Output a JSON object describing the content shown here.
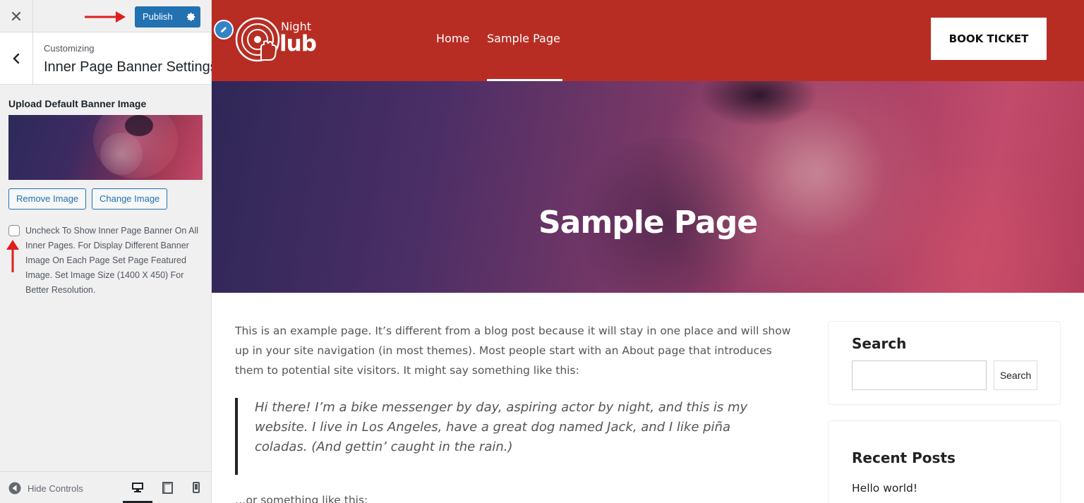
{
  "customizer": {
    "close_icon": "close-icon",
    "publish_label": "Publish",
    "settings_icon": "gear-icon",
    "customizing_label": "Customizing",
    "section_title": "Inner Page Banner Settings",
    "control_title": "Upload Default Banner Image",
    "remove_image_label": "Remove Image",
    "change_image_label": "Change Image",
    "checkbox_checked": false,
    "checkbox_label": "Uncheck To Show Inner Page Banner On All Inner Pages. For Display Different Banner Image On Each Page Set Page Featured Image. Set Image Size (1400 X 450) For Better Resolution.",
    "hide_controls_label": "Hide Controls",
    "devices": [
      "desktop",
      "tablet",
      "mobile"
    ],
    "active_device": "desktop",
    "accent_color": "#2271b1",
    "annotation_arrow_color": "#e01e1e"
  },
  "site": {
    "logo_top": "Night",
    "logo_bottom": "lub",
    "nav": [
      {
        "label": "Home",
        "active": false
      },
      {
        "label": "Sample Page",
        "active": true
      }
    ],
    "cta_label": "BOOK TICKET",
    "header_color": "#b82d23"
  },
  "page": {
    "banner_title": "Sample Page",
    "intro_lines": [
      "This is an example page. It’s different from a blog post because it will stay in one place and will show",
      "up in your site navigation (in most themes). Most people start with an About page that introduces",
      "them to potential site visitors. It might say something like this:"
    ],
    "quote_lines": [
      "Hi there! I’m a bike messenger by day, aspiring actor by night, and this is my",
      "website. I live in Los Angeles, have a great dog named Jack, and I like piña",
      "coladas. (And gettin’ caught in the rain.)"
    ],
    "after_quote": "…or something like this:"
  },
  "sidebar_widgets": {
    "search_title": "Search",
    "search_button": "Search",
    "search_value": "",
    "recent_title": "Recent Posts",
    "recent_posts": [
      "Hello world!"
    ]
  }
}
